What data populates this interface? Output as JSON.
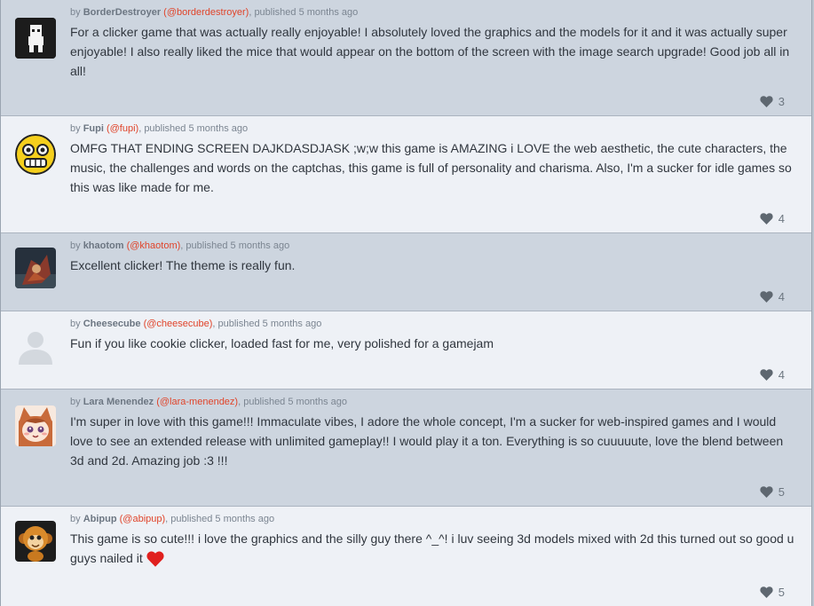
{
  "comments": [
    {
      "author": "BorderDestroyer",
      "handle": "(@borderdestroyer)",
      "published": ", published 5 months ago",
      "text": "For a clicker game that was actually really enjoyable! I absolutely loved the graphics and the models for it and it was actually super enjoyable! I also really liked the mice that would appear on the bottom of the screen with the image search upgrade! Good job all in all!",
      "likes": "3",
      "avatar_icon": "pixel-character-icon",
      "background": "#cdd5df"
    },
    {
      "author": "Fupi",
      "handle": "(@fupi)",
      "published": ", published 5 months ago",
      "text": "OMFG THAT ENDING SCREEN DAJKDASDJASK ;w;w this game is AMAZING i LOVE the web aesthetic, the cute characters, the music, the challenges and words on the captchas, this game is full of personality and charisma. Also, I'm a sucker for idle games so this was like made for me.",
      "likes": "4",
      "avatar_icon": "yellow-face-icon",
      "background": "#eef1f6"
    },
    {
      "author": "khaotom",
      "handle": "(@khaotom)",
      "published": ", published 5 months ago",
      "text": "Excellent clicker! The theme is really fun.",
      "likes": "4",
      "avatar_icon": "dark-artwork-icon",
      "background": "#cdd5df"
    },
    {
      "author": "Cheesecube",
      "handle": "(@cheesecube)",
      "published": ", published 5 months ago",
      "text": "Fun if you like cookie clicker, loaded fast for me, very polished for a gamejam",
      "likes": "4",
      "avatar_icon": "default-user-icon",
      "background": "#eef1f6"
    },
    {
      "author": "Lara Menendez",
      "handle": "(@lara-menendez)",
      "published": ", published 5 months ago",
      "text": "I'm super in love with this game!!! Immaculate vibes, I adore the whole concept, I'm a sucker for web-inspired games and I would love to see an extended release with unlimited gameplay!! I would play it a ton. Everything is so cuuuuute, love the blend between 3d and 2d. Amazing job :3 !!!",
      "likes": "5",
      "avatar_icon": "anime-cat-girl-icon",
      "background": "#cdd5df"
    },
    {
      "author": "Abipup",
      "handle": "(@abipup)",
      "published": ", published 5 months ago",
      "text": "This game is so cute!!! i love the graphics and the silly guy there ^_^! i luv seeing 3d models mixed with 2d this turned out so good u guys nailed it",
      "likes": "5",
      "avatar_icon": "monkey-icon",
      "background": "#eef1f6"
    }
  ],
  "colors": {
    "handle": "#e0442a",
    "heart_emoji": "#e0201e",
    "like_heart": "#5e6770"
  }
}
